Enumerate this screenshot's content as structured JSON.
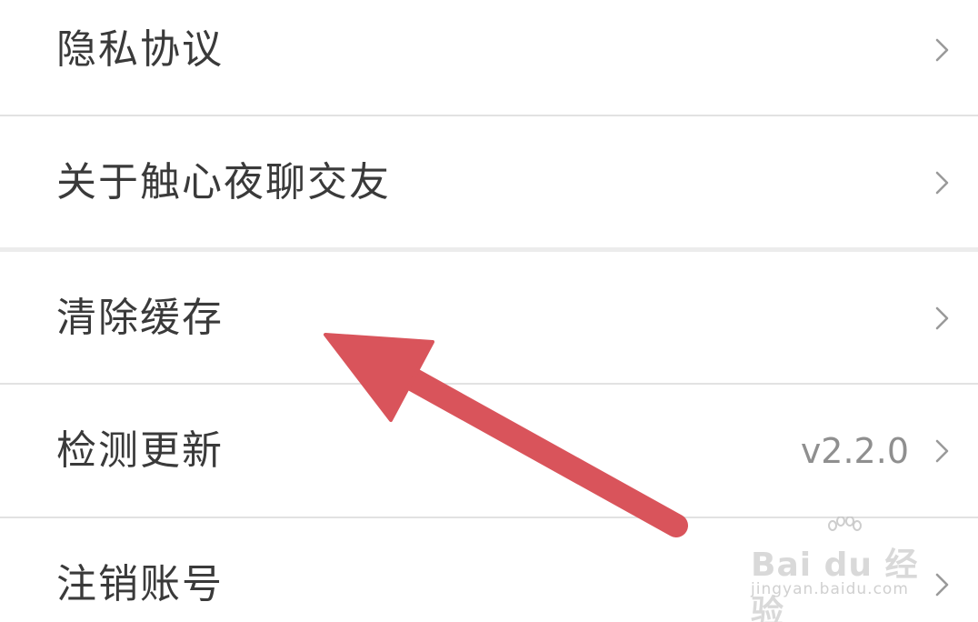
{
  "settings": {
    "items": [
      {
        "label": "隐私协议",
        "value": "",
        "icon": "chevron-right-icon"
      },
      {
        "label": "关于触心夜聊交友",
        "value": "",
        "icon": "chevron-right-icon"
      },
      {
        "label": "清除缓存",
        "value": "",
        "icon": "chevron-right-icon"
      },
      {
        "label": "检测更新",
        "value": "v2.2.0",
        "icon": "chevron-right-icon"
      },
      {
        "label": "注销账号",
        "value": "",
        "icon": "chevron-right-icon"
      }
    ]
  },
  "annotation": {
    "arrow_color": "#d9545b",
    "target": "清除缓存"
  },
  "watermark": {
    "brand": "Bai du 经验",
    "url": "jingyan.baidu.com"
  },
  "colors": {
    "background": "#ffffff",
    "label_text": "#3a3a3a",
    "value_text": "#8f8f8f",
    "divider": "#e2e2e2"
  }
}
